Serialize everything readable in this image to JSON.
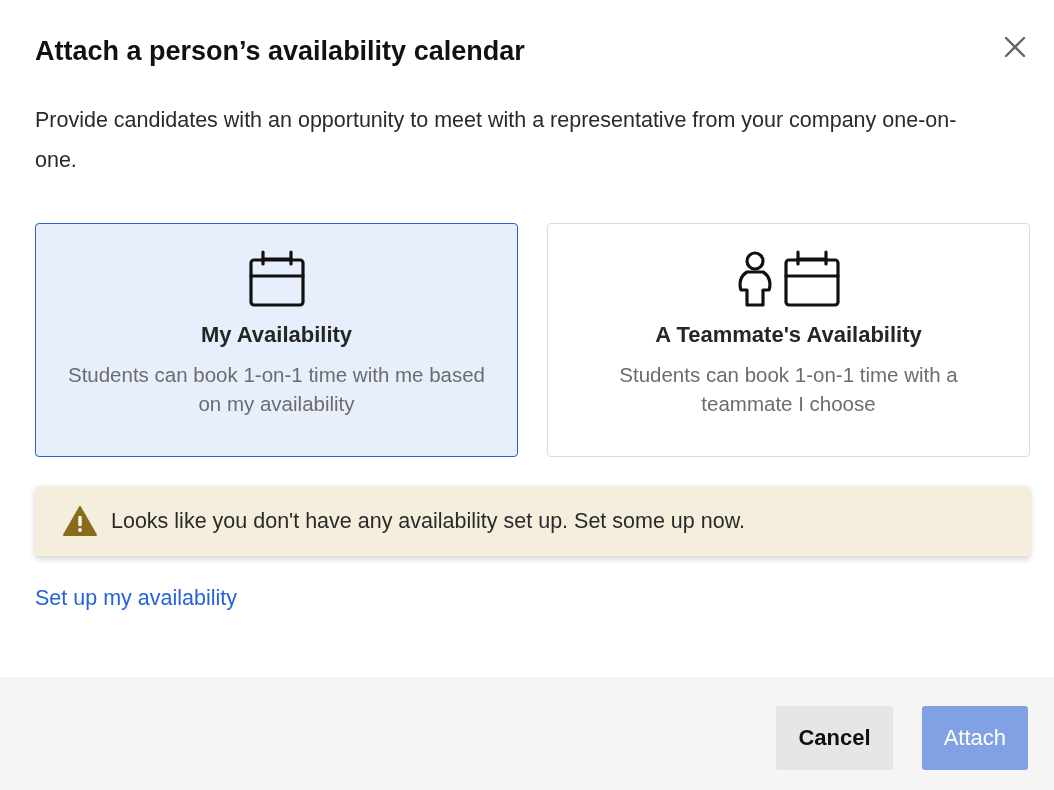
{
  "dialog": {
    "title": "Attach a person’s availability calendar",
    "description": "Provide candidates with an opportunity to meet with a representative from your company one-on-one."
  },
  "options": [
    {
      "kind": "self",
      "title": "My Availability",
      "description": "Students can book 1-on-1 time with me based on my availability",
      "selected": true
    },
    {
      "kind": "teammate",
      "title": "A Teammate's Availability",
      "description": "Students can book 1-on-1 time with a teammate I choose",
      "selected": false
    }
  ],
  "warning": {
    "text": "Looks like you don't have any availability set up. Set some up now."
  },
  "link": "Set up my availability",
  "buttons": [
    {
      "label": "Cancel",
      "kind": "secondary",
      "disabled": false
    },
    {
      "label": "Attach",
      "kind": "primary",
      "disabled": true
    }
  ]
}
